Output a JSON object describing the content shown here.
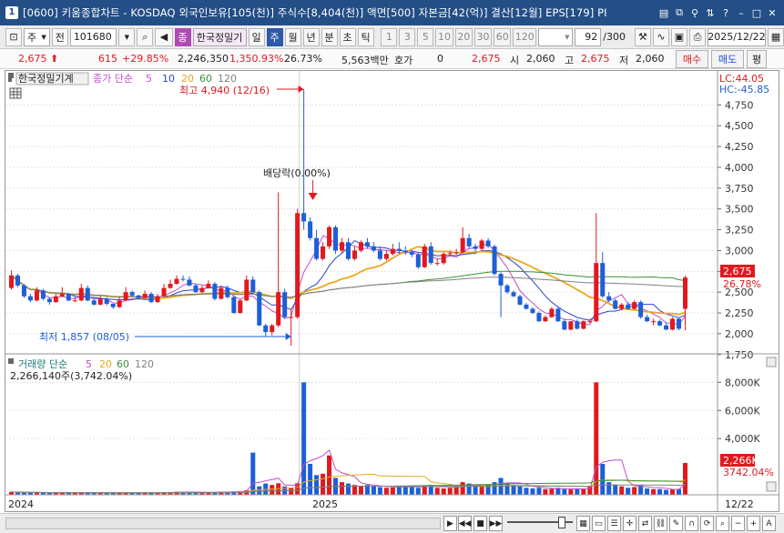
{
  "window": {
    "number": "1",
    "title": "[0600] 키움종합차트 - KOSDAQ 외국인보유[105(천)] 주식수[8,404(천)] 액면[500] 자본금[42(억)] 결산[12월] EPS[179] PI"
  },
  "toolbar": {
    "period_unit": "주",
    "prev_label": "전",
    "stock_code": "101680",
    "tag_label": "종",
    "stock_name": "한국정밀기",
    "periods": [
      "일",
      "주",
      "월",
      "년",
      "분",
      "초",
      "틱"
    ],
    "selected_period": "주",
    "intervals": [
      "1",
      "3",
      "5",
      "10",
      "20",
      "30",
      "60",
      "120"
    ],
    "count_value": "92",
    "count_total": "/300",
    "date": "2025/12/22"
  },
  "quote": {
    "price": "2,675",
    "change": "615",
    "change_pct": "+29.85%",
    "volume": "2,246,350",
    "volume_ratio": "1,350.93%",
    "turnover": "26.73%",
    "amount": "5,563백만",
    "hoga_label": "호가",
    "hoga_value": "0",
    "hoga_price": "2,675",
    "open_label": "시",
    "open": "2,060",
    "high_label": "고",
    "high": "2,675",
    "low_label": "저",
    "low": "2,060",
    "buy_label": "매수",
    "sell_label": "매도",
    "avg_label": "평"
  },
  "price_panel": {
    "stock_label": "한국정밀기계",
    "ma_label": "종가 단순",
    "ma_periods": [
      "5",
      "10",
      "20",
      "60",
      "120"
    ],
    "ma_colors": [
      "#c04fc8",
      "#2b43c9",
      "#e8a820",
      "#3a8f3a",
      "#808080"
    ],
    "lc": "LC:44.05",
    "hc": "HC:-45.85",
    "high_annotation": "최고 4,940 (12/16)",
    "low_annotation": "최저 1,857 (08/05)",
    "event_annotation": "배당락(0.00%)",
    "current_price_label": "2,675",
    "current_pct_label": "26.78%",
    "y_ticks": [
      "4,750",
      "4,500",
      "4,250",
      "4,000",
      "3,750",
      "3,500",
      "3,250",
      "3,000",
      "2,750",
      "2,500",
      "2,250",
      "2,000",
      "1,750"
    ]
  },
  "volume_panel": {
    "title": "거래량 단순",
    "ma_periods": [
      "5",
      "20",
      "60",
      "120"
    ],
    "ma_colors": [
      "#c04fc8",
      "#e8a820",
      "#3a8f3a",
      "#808080"
    ],
    "current": "2,266,140주(3,742.04%)",
    "y_ticks": [
      "8,000K",
      "6,000K",
      "4,000K"
    ],
    "current_label": "2,266K",
    "current_pct": "3742.04%"
  },
  "x_axis": {
    "labels": [
      "2024",
      "2025",
      "12/22"
    ]
  },
  "colors": {
    "up": "#e1191e",
    "down": "#1d5fd8",
    "titlebar": "#234e86"
  },
  "chart_data": {
    "type": "candlestick",
    "open": [
      2550,
      2700,
      2580,
      2450,
      2400,
      2520,
      2420,
      2380,
      2450,
      2480,
      2400,
      2400,
      2550,
      2400,
      2350,
      2420,
      2360,
      2320,
      2400,
      2500,
      2460,
      2430,
      2480,
      2380,
      2450,
      2550,
      2600,
      2660,
      2650,
      2580,
      2500,
      2550,
      2600,
      2420,
      2550,
      2440,
      2250,
      2400,
      2650,
      2500,
      2100,
      2020,
      2100,
      2500,
      2200,
      2200,
      3450,
      3350,
      3150,
      2900,
      3050,
      3280,
      3000,
      3100,
      2900,
      3000,
      3100,
      3050,
      3000,
      2900,
      2960,
      3020,
      3000,
      2980,
      2950,
      2800,
      3050,
      2850,
      2850,
      2960,
      2970,
      2980,
      3150,
      3050,
      3020,
      3120,
      3050,
      2720,
      2580,
      2500,
      2450,
      2350,
      2300,
      2250,
      2150,
      2200,
      2300,
      2150,
      2050,
      2150,
      2060,
      2150,
      2150,
      2850,
      2450,
      2400,
      2300,
      2350,
      2300,
      2380,
      2200,
      2150,
      2150,
      2100,
      2050,
      2180,
      2300
    ],
    "close": [
      2700,
      2580,
      2450,
      2400,
      2520,
      2420,
      2380,
      2450,
      2480,
      2400,
      2400,
      2550,
      2400,
      2350,
      2420,
      2360,
      2320,
      2400,
      2500,
      2460,
      2430,
      2480,
      2380,
      2450,
      2550,
      2600,
      2660,
      2650,
      2580,
      2500,
      2550,
      2600,
      2420,
      2550,
      2440,
      2250,
      2400,
      2650,
      2500,
      2100,
      2020,
      2100,
      2500,
      2200,
      2200,
      3450,
      3350,
      3150,
      2900,
      3050,
      3280,
      3000,
      3100,
      2900,
      3000,
      3100,
      3050,
      3000,
      2900,
      2960,
      3020,
      3000,
      2980,
      2950,
      2800,
      3050,
      2850,
      2850,
      2960,
      2970,
      2980,
      3150,
      3050,
      3020,
      3120,
      3050,
      2720,
      2580,
      2500,
      2450,
      2350,
      2300,
      2250,
      2150,
      2200,
      2300,
      2150,
      2050,
      2150,
      2060,
      2150,
      2150,
      2850,
      2450,
      2400,
      2300,
      2350,
      2300,
      2380,
      2200,
      2150,
      2150,
      2100,
      2050,
      2180,
      2060,
      2675
    ],
    "high": [
      2760,
      2720,
      2600,
      2480,
      2560,
      2540,
      2440,
      2480,
      2560,
      2490,
      2440,
      2600,
      2580,
      2420,
      2450,
      2440,
      2360,
      2440,
      2560,
      2520,
      2470,
      2520,
      2500,
      2480,
      2600,
      2650,
      2700,
      2700,
      2690,
      2600,
      2580,
      2640,
      2620,
      2580,
      2580,
      2460,
      2420,
      2700,
      2690,
      2520,
      2120,
      2120,
      3700,
      2540,
      2300,
      3500,
      4940,
      3400,
      3250,
      3100,
      3300,
      3300,
      3150,
      3150,
      3050,
      3120,
      3150,
      3100,
      3050,
      3000,
      3080,
      3100,
      3050,
      3000,
      2970,
      3080,
      3100,
      2900,
      2980,
      3000,
      3020,
      3280,
      3200,
      3080,
      3140,
      3150,
      3070,
      2740,
      2600,
      2520,
      2470,
      2370,
      2320,
      2270,
      2220,
      2320,
      2320,
      2180,
      2080,
      2170,
      2160,
      2180,
      3450,
      2980,
      2500,
      2420,
      2370,
      2380,
      2400,
      2400,
      2230,
      2180,
      2170,
      2130,
      2200,
      2190,
      2700
    ],
    "low": [
      2530,
      2560,
      2430,
      2380,
      2390,
      2400,
      2350,
      2370,
      2440,
      2390,
      2380,
      2390,
      2390,
      2340,
      2340,
      2340,
      2300,
      2310,
      2390,
      2440,
      2420,
      2420,
      2370,
      2370,
      2440,
      2540,
      2590,
      2630,
      2570,
      2490,
      2490,
      2540,
      2400,
      2410,
      2420,
      2240,
      2240,
      2390,
      2480,
      2090,
      1960,
      1980,
      2080,
      2180,
      1857,
      2180,
      3250,
      3120,
      2880,
      2880,
      3020,
      2960,
      2970,
      2880,
      2880,
      2980,
      3020,
      2980,
      2880,
      2880,
      2940,
      2960,
      2950,
      2920,
      2780,
      2790,
      2830,
      2820,
      2830,
      2940,
      2950,
      2960,
      3020,
      2990,
      3000,
      3030,
      2700,
      2200,
      2480,
      2440,
      2340,
      2290,
      2240,
      2140,
      2140,
      2190,
      2140,
      2040,
      2040,
      2050,
      2050,
      2130,
      2140,
      2430,
      2380,
      2290,
      2280,
      2290,
      2290,
      2180,
      2140,
      2100,
      2090,
      2040,
      2040,
      2040,
      2040
    ],
    "volume": [
      200,
      180,
      150,
      140,
      160,
      150,
      120,
      130,
      170,
      150,
      130,
      180,
      160,
      120,
      130,
      120,
      110,
      120,
      160,
      130,
      120,
      140,
      130,
      140,
      180,
      200,
      220,
      200,
      180,
      160,
      170,
      190,
      200,
      220,
      180,
      240,
      260,
      320,
      3000,
      600,
      800,
      700,
      820,
      600,
      500,
      820,
      8000,
      2200,
      1400,
      1500,
      2800,
      1200,
      900,
      800,
      700,
      650,
      700,
      600,
      550,
      500,
      520,
      600,
      650,
      550,
      500,
      650,
      700,
      500,
      450,
      500,
      520,
      900,
      800,
      600,
      600,
      700,
      900,
      1200,
      800,
      700,
      600,
      500,
      450,
      500,
      400,
      420,
      500,
      400,
      380,
      420,
      400,
      600,
      8000,
      2200,
      900,
      700,
      600,
      500,
      550,
      700,
      450,
      400,
      400,
      350,
      380,
      420,
      2266
    ]
  }
}
